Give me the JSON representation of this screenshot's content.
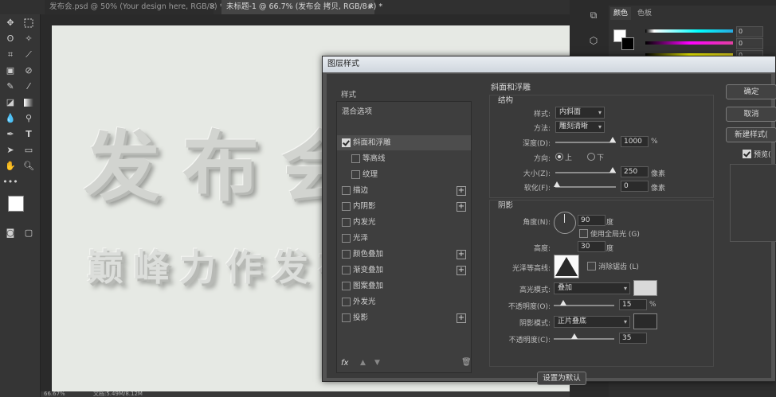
{
  "tabs": [
    {
      "title": "发布会.psd @ 50% (Your design here, RGB/8) *",
      "active": false
    },
    {
      "title": "未标题-1 @ 66.7% (发布会 拷贝, RGB/8#) *",
      "active": true
    }
  ],
  "canvas": {
    "headline": "发布会",
    "subline": "巅峰力作发布"
  },
  "status": {
    "zoom": "66.67%",
    "doc": "文档:5.49M/8.12M"
  },
  "color_panel": {
    "tab_color": "颜色",
    "tab_swatches": "色板",
    "values": [
      "0",
      "0",
      "0"
    ]
  },
  "dialog": {
    "title": "图层样式",
    "sidebar_header": "样式",
    "blend_options": "混合选项",
    "effects": [
      {
        "label": "斜面和浮雕",
        "checked": true,
        "plus": false,
        "indent": false,
        "selected": true
      },
      {
        "label": "等高线",
        "checked": false,
        "plus": false,
        "indent": true
      },
      {
        "label": "纹理",
        "checked": false,
        "plus": false,
        "indent": true
      },
      {
        "label": "描边",
        "checked": false,
        "plus": true,
        "indent": false
      },
      {
        "label": "内阴影",
        "checked": false,
        "plus": true,
        "indent": false
      },
      {
        "label": "内发光",
        "checked": false,
        "plus": false,
        "indent": false
      },
      {
        "label": "光泽",
        "checked": false,
        "plus": false,
        "indent": false
      },
      {
        "label": "颜色叠加",
        "checked": false,
        "plus": true,
        "indent": false
      },
      {
        "label": "渐变叠加",
        "checked": false,
        "plus": true,
        "indent": false
      },
      {
        "label": "图案叠加",
        "checked": false,
        "plus": false,
        "indent": false
      },
      {
        "label": "外发光",
        "checked": false,
        "plus": false,
        "indent": false
      },
      {
        "label": "投影",
        "checked": false,
        "plus": true,
        "indent": false
      }
    ],
    "fx_label": "fx",
    "section_title": "斜面和浮雕",
    "structure": {
      "title": "结构",
      "style_label": "样式:",
      "style_value": "内斜面",
      "technique_label": "方法:",
      "technique_value": "雕刻清晰",
      "depth_label": "深度(D):",
      "depth_value": "1000",
      "depth_unit": "%",
      "direction_label": "方向:",
      "dir_up": "上",
      "dir_down": "下",
      "size_label": "大小(Z):",
      "size_value": "250",
      "size_unit": "像素",
      "soften_label": "软化(F):",
      "soften_value": "0",
      "soften_unit": "像素"
    },
    "shading": {
      "title": "阴影",
      "angle_label": "角度(N):",
      "angle_value": "90",
      "angle_unit": "度",
      "global_light": "使用全局光 (G)",
      "altitude_label": "高度:",
      "altitude_value": "30",
      "altitude_unit": "度",
      "gloss_label": "光泽等高线:",
      "anti_alias": "消除锯齿 (L)",
      "highlight_label": "高光模式:",
      "highlight_value": "叠加",
      "h_opacity_label": "不透明度(O):",
      "h_opacity_value": "15",
      "h_opacity_unit": "%",
      "shadow_label": "阴影模式:",
      "shadow_value": "正片叠底",
      "s_opacity_label": "不透明度(C):",
      "s_opacity_value": "35"
    },
    "default_button": "设置为默认"
  },
  "right_buttons": {
    "ok": "确定",
    "cancel": "取消",
    "new_style": "新建样式(",
    "preview": "预览("
  }
}
